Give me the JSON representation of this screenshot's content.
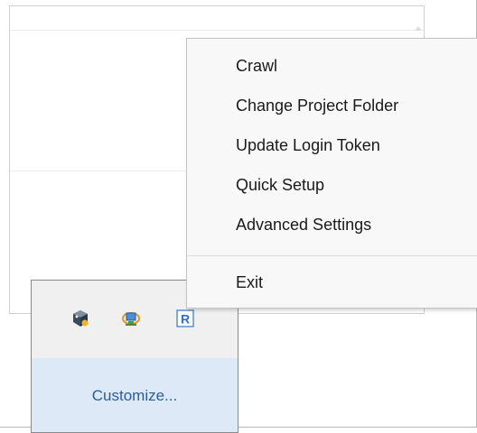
{
  "context_menu": {
    "items": [
      {
        "label": "Crawl"
      },
      {
        "label": "Change Project Folder"
      },
      {
        "label": "Update Login Token"
      },
      {
        "label": "Quick Setup"
      },
      {
        "label": "Advanced Settings"
      }
    ],
    "exit_label": "Exit"
  },
  "tray_overflow": {
    "icons": [
      {
        "name": "virtualbox-cube-icon"
      },
      {
        "name": "network-computer-icon"
      },
      {
        "name": "r-app-icon",
        "letter": "R"
      }
    ],
    "customize_label": "Customize..."
  },
  "colors": {
    "menu_background": "#f8f8f8",
    "tray_background": "#f0f0f0",
    "customize_background": "#dde9f6",
    "customize_link": "#2b5d9a"
  }
}
